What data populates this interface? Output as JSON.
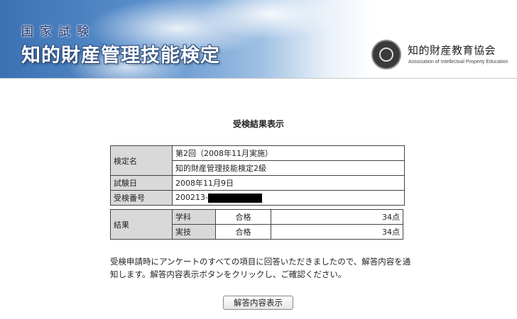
{
  "banner": {
    "subtitle": "国家試験",
    "title": "知的財産管理技能検定",
    "org_name": "知的財産教育協会",
    "org_name_en": "Association of Intellectual Property Education",
    "logo_icon": "emblem-icon"
  },
  "heading": "受検結果表示",
  "info_table": {
    "exam_label": "検定名",
    "exam_round": "第2回（2008年11月実施）",
    "exam_name": "知的財産管理技能検定2級",
    "date_label": "試験日",
    "date_value": "2008年11月9日",
    "id_label": "受検番号",
    "id_value": "200213-"
  },
  "result_table": {
    "label": "結果",
    "rows": [
      {
        "subject": "学科",
        "status": "合格",
        "score": "34点"
      },
      {
        "subject": "実技",
        "status": "合格",
        "score": "34点"
      }
    ]
  },
  "notice": "受検申請時にアンケートのすべての項目に回答いただきましたので、解答内容を通知します。解答内容表示ボタンをクリックし、ご確認ください。",
  "button_label": "解答内容表示"
}
